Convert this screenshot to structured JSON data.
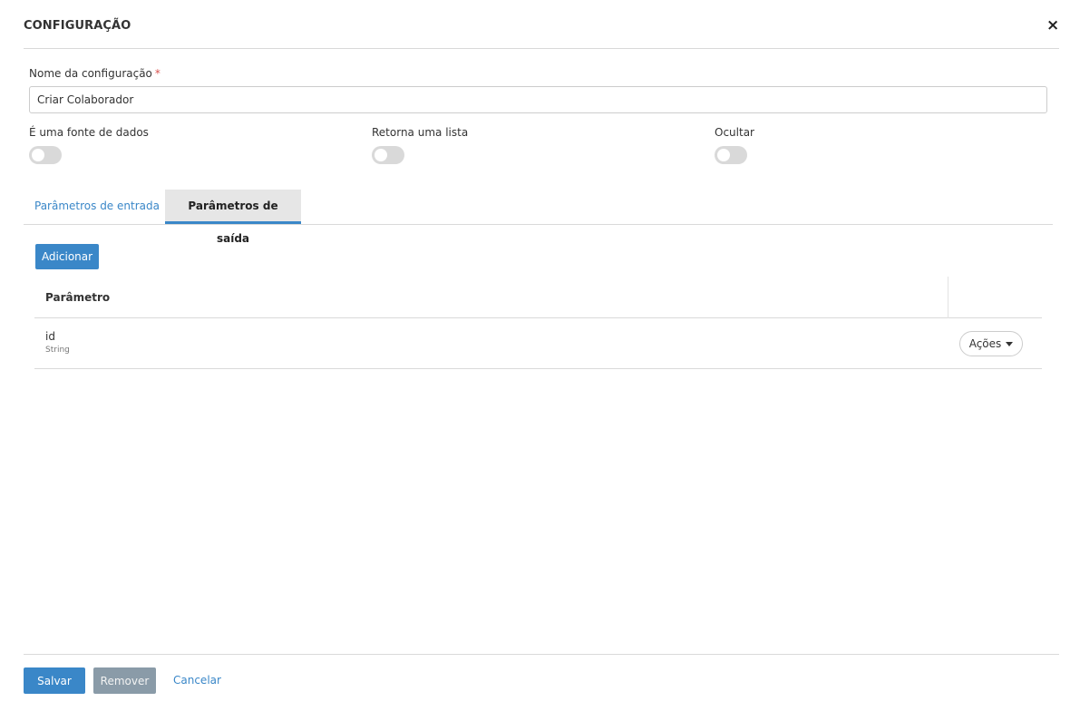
{
  "modal": {
    "title": "CONFIGURAÇÃO",
    "close_icon": "close-icon",
    "close_glyph": "×"
  },
  "form": {
    "name_label": "Nome da configuração",
    "required_mark": "*",
    "name_value": "Criar Colaborador",
    "toggles": [
      {
        "label": "É uma fonte de dados",
        "checked": false
      },
      {
        "label": "Retorna uma lista",
        "checked": false
      },
      {
        "label": "Ocultar",
        "checked": false
      }
    ]
  },
  "tabs": [
    {
      "label": "Parâmetros de entrada",
      "active": false
    },
    {
      "label": "Parâmetros de saída",
      "active": true
    }
  ],
  "output_params": {
    "add_label": "Adicionar",
    "columns": [
      "Parâmetro",
      ""
    ],
    "rows": [
      {
        "name": "id",
        "type": "String",
        "actions_label": "Ações"
      }
    ]
  },
  "footer": {
    "save_label": "Salvar",
    "remove_label": "Remover",
    "cancel_label": "Cancelar"
  },
  "colors": {
    "accent": "#3a87c8",
    "required": "#d9534f",
    "remove_button": "#8a9ba8",
    "toggle_off": "#d9d9d9"
  }
}
